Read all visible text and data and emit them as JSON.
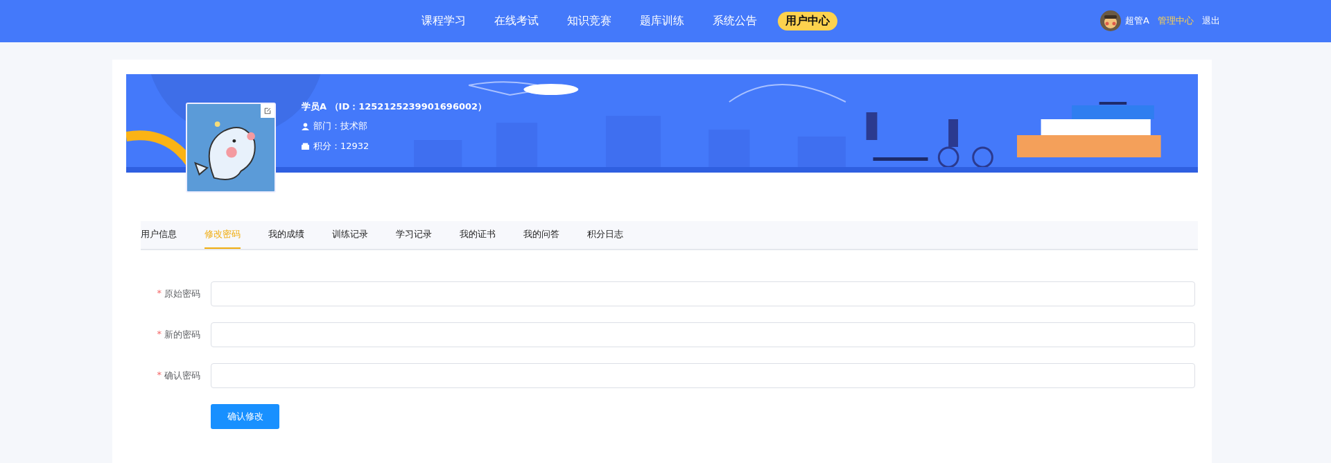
{
  "nav": {
    "items": [
      {
        "label": "课程学习",
        "selected": false
      },
      {
        "label": "在线考试",
        "selected": false
      },
      {
        "label": "知识竞赛",
        "selected": false
      },
      {
        "label": "题库训练",
        "selected": false
      },
      {
        "label": "系统公告",
        "selected": false
      },
      {
        "label": "用户中心",
        "selected": true
      }
    ],
    "user": {
      "name": "超管A",
      "admin_link": "管理中心",
      "logout": "退出"
    }
  },
  "profile": {
    "name_line": "学员A （ID：1252125239901696002）",
    "department_label": "部门：",
    "department": "技术部",
    "points_label": "积分：",
    "points": "12932"
  },
  "tabs": [
    {
      "label": "用户信息",
      "selected": false
    },
    {
      "label": "修改密码",
      "selected": true
    },
    {
      "label": "我的成绩",
      "selected": false
    },
    {
      "label": "训练记录",
      "selected": false
    },
    {
      "label": "学习记录",
      "selected": false
    },
    {
      "label": "我的证书",
      "selected": false
    },
    {
      "label": "我的问答",
      "selected": false
    },
    {
      "label": "积分日志",
      "selected": false
    }
  ],
  "form": {
    "fields": [
      {
        "label": "原始密码",
        "required_mark": "*"
      },
      {
        "label": "新的密码",
        "required_mark": "*"
      },
      {
        "label": "确认密码",
        "required_mark": "*"
      }
    ],
    "submit": "确认修改"
  }
}
